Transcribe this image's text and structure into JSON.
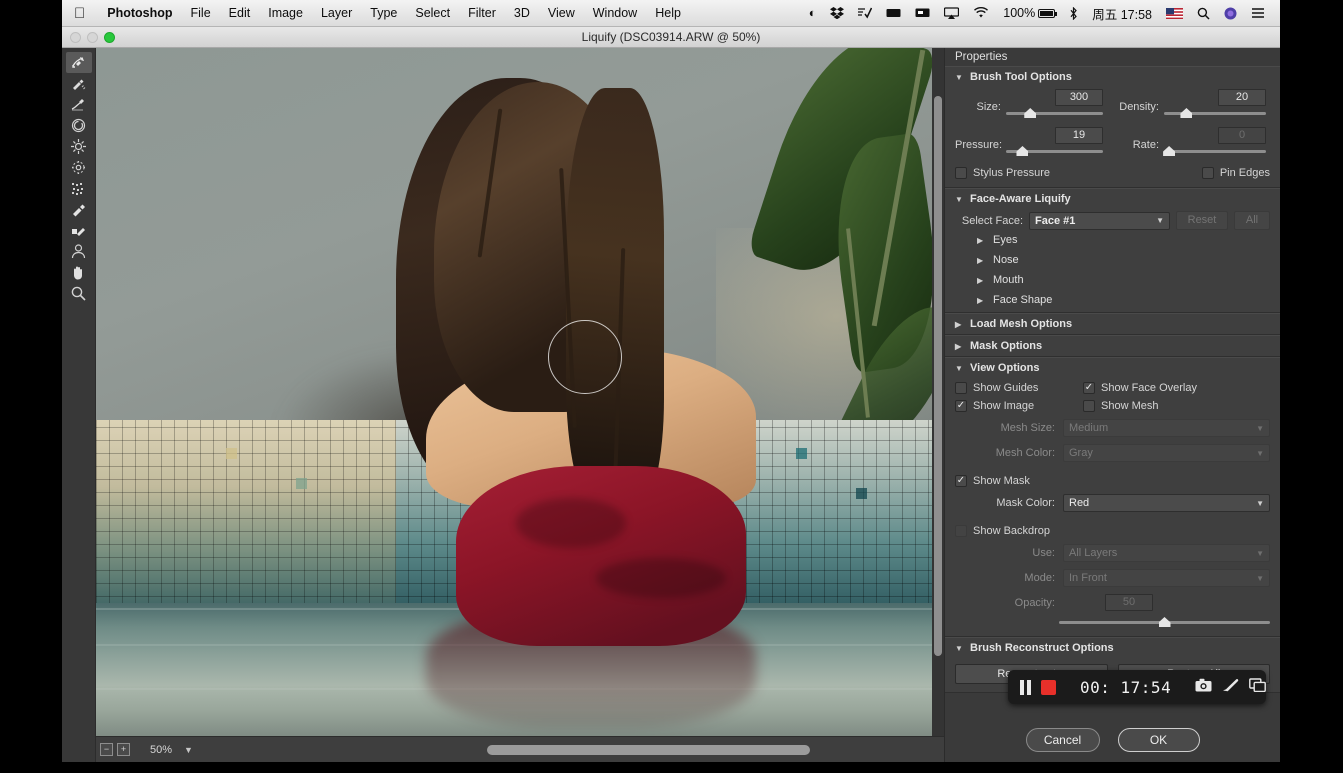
{
  "menubar": {
    "apple_icon": "apple-logo",
    "items": [
      {
        "label": "Photoshop",
        "bold": true
      },
      {
        "label": "File",
        "bold": false
      },
      {
        "label": "Edit",
        "bold": false
      },
      {
        "label": "Image",
        "bold": false
      },
      {
        "label": "Layer",
        "bold": false
      },
      {
        "label": "Type",
        "bold": false
      },
      {
        "label": "Select",
        "bold": false
      },
      {
        "label": "Filter",
        "bold": false
      },
      {
        "label": "3D",
        "bold": false
      },
      {
        "label": "View",
        "bold": false
      },
      {
        "label": "Window",
        "bold": false
      },
      {
        "label": "Help",
        "bold": false
      }
    ],
    "status": {
      "contrast_icon": "◐",
      "dropbox_icon": "dropbox-icon",
      "list_check_icon": "≡✓",
      "display_icon": "▬",
      "monitor_icon": "monitor-icon",
      "airplay_icon": "airplay-icon",
      "wifi_icon": "wifi-icon",
      "battery_percent": "100%",
      "bluetooth_icon": "✻",
      "clock": "周五 17:58",
      "flag_icon": "us-flag",
      "search_icon": "search-icon",
      "siri_icon": "siri-icon",
      "notification_icon": "notification-center-icon"
    }
  },
  "window": {
    "title": "Liquify (DSC03914.ARW @ 50%)",
    "traffic": {
      "close": "close-button",
      "minimize": "minimize-button",
      "zoom": "zoom-button"
    }
  },
  "toolbar": {
    "tools": [
      {
        "name": "forward-warp-tool",
        "selected": true
      },
      {
        "name": "reconstruct-tool",
        "selected": false
      },
      {
        "name": "smooth-tool",
        "selected": false
      },
      {
        "name": "twirl-clockwise-tool",
        "selected": false
      },
      {
        "name": "pucker-tool",
        "selected": false
      },
      {
        "name": "bloat-tool",
        "selected": false
      },
      {
        "name": "push-left-tool",
        "selected": false
      },
      {
        "name": "freeze-mask-tool",
        "selected": false
      },
      {
        "name": "thaw-mask-tool",
        "selected": false
      },
      {
        "name": "face-tool",
        "selected": false
      },
      {
        "name": "hand-tool",
        "selected": false
      },
      {
        "name": "zoom-tool",
        "selected": false
      }
    ]
  },
  "canvas": {
    "zoom_out_label": "−",
    "zoom_in_label": "+",
    "zoom_level": "50%"
  },
  "properties": {
    "panel_title": "Properties",
    "brush_tool_options": {
      "title": "Brush Tool Options",
      "expanded": true,
      "size_label": "Size:",
      "size_value": "300",
      "size_slider_pct": 25,
      "density_label": "Density:",
      "density_value": "20",
      "density_slider_pct": 22,
      "pressure_label": "Pressure:",
      "pressure_value": "19",
      "pressure_slider_pct": 17,
      "rate_label": "Rate:",
      "rate_value": "0",
      "rate_slider_pct": 5,
      "stylus_pressure_label": "Stylus Pressure",
      "stylus_pressure_checked": false,
      "pin_edges_label": "Pin Edges",
      "pin_edges_checked": false
    },
    "face_aware_liquify": {
      "title": "Face-Aware Liquify",
      "expanded": true,
      "select_face_label": "Select Face:",
      "select_face_value": "Face #1",
      "reset_label": "Reset",
      "all_label": "All",
      "subsections": [
        "Eyes",
        "Nose",
        "Mouth",
        "Face Shape"
      ]
    },
    "load_mesh_options": {
      "title": "Load Mesh Options",
      "expanded": false
    },
    "mask_options": {
      "title": "Mask Options",
      "expanded": false
    },
    "view_options": {
      "title": "View Options",
      "expanded": true,
      "show_guides_label": "Show Guides",
      "show_guides_checked": false,
      "show_face_overlay_label": "Show Face Overlay",
      "show_face_overlay_checked": true,
      "show_image_label": "Show Image",
      "show_image_checked": true,
      "show_mesh_label": "Show Mesh",
      "show_mesh_checked": false,
      "mesh_size_label": "Mesh Size:",
      "mesh_size_value": "Medium",
      "mesh_color_label": "Mesh Color:",
      "mesh_color_value": "Gray",
      "show_mask_label": "Show Mask",
      "show_mask_checked": true,
      "mask_color_label": "Mask Color:",
      "mask_color_value": "Red",
      "show_backdrop_label": "Show Backdrop",
      "show_backdrop_checked": false,
      "use_label": "Use:",
      "use_value": "All Layers",
      "mode_label": "Mode:",
      "mode_value": "In Front",
      "opacity_label": "Opacity:",
      "opacity_value": "50",
      "opacity_slider_pct": 50
    },
    "brush_reconstruct_options": {
      "title": "Brush Reconstruct Options",
      "expanded": true,
      "reconstruct_label": "Reconstruct...",
      "restore_all_label": "Restore All"
    },
    "cancel_label": "Cancel",
    "ok_label": "OK"
  },
  "recorder": {
    "pause_icon": "pause-icon",
    "stop_icon": "stop-record-icon",
    "time": "00: 17:54",
    "camera_icon": "camera-icon",
    "pen_icon": "pen-icon",
    "window_icon": "window-icon",
    "record_color": "#e8302a"
  }
}
